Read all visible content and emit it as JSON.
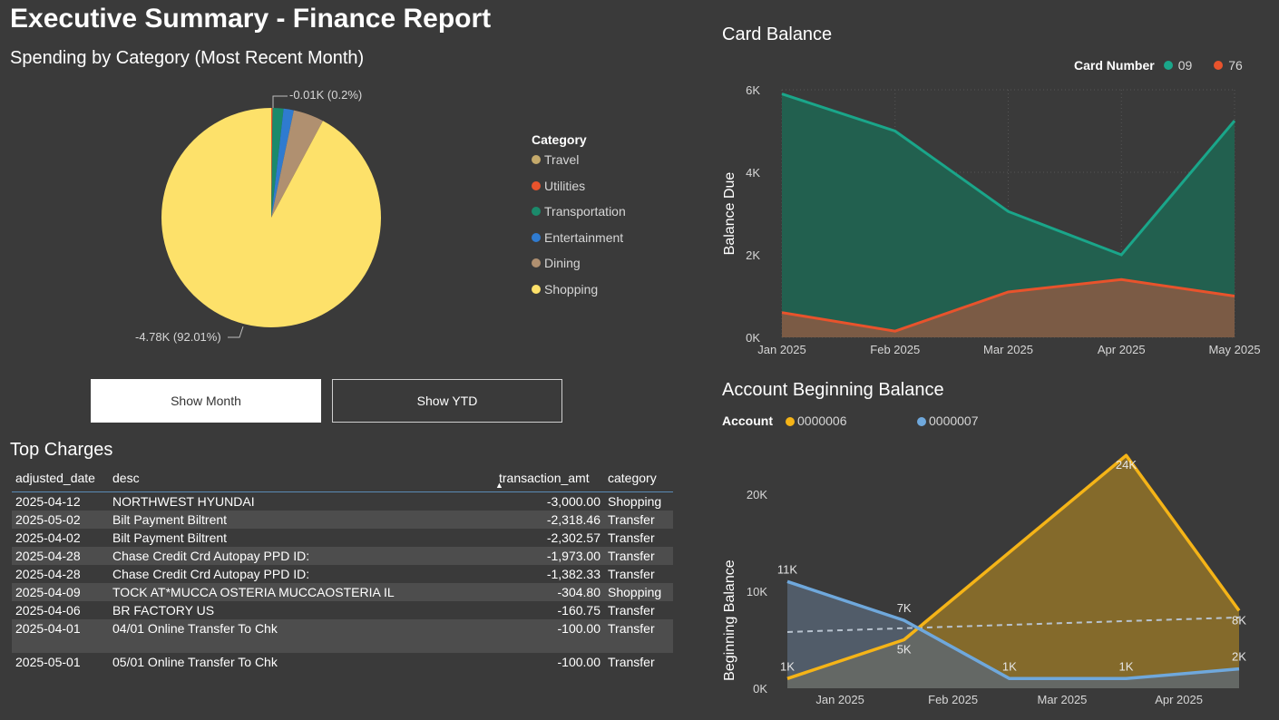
{
  "title": "Executive Summary - Finance Report",
  "pie": {
    "title": "Spending by Category (Most Recent Month)",
    "legend_title": "Category",
    "callout_top": "-0.01K (0.2%)",
    "callout_bottom": "-4.78K (92.01%)",
    "categories": [
      {
        "name": "Travel",
        "color": "#c4a96b"
      },
      {
        "name": "Utilities",
        "color": "#e8532c"
      },
      {
        "name": "Transportation",
        "color": "#1b8a6b"
      },
      {
        "name": "Entertainment",
        "color": "#2f7bd0"
      },
      {
        "name": "Dining",
        "color": "#b09070"
      },
      {
        "name": "Shopping",
        "color": "#fde16a"
      }
    ]
  },
  "buttons": {
    "month": "Show Month",
    "ytd": "Show YTD"
  },
  "card_balance": {
    "title": "Card Balance",
    "legend_title": "Card Number",
    "ylabel": "Balance Due",
    "yticks": [
      "0K",
      "2K",
      "4K",
      "6K"
    ],
    "xticks": [
      "Jan 2025",
      "Feb 2025",
      "Mar 2025",
      "Apr 2025",
      "May 2025"
    ]
  },
  "account_balance": {
    "title": "Account Beginning Balance",
    "legend_title": "Account",
    "ylabel": "Beginning Balance",
    "yticks": [
      "0K",
      "10K",
      "20K"
    ],
    "xticks": [
      "Jan 2025",
      "Feb 2025",
      "Mar 2025",
      "Apr 2025"
    ]
  },
  "chart_data": [
    {
      "type": "area",
      "title": "Card Balance",
      "ylabel": "Balance Due",
      "x": [
        "Jan 2025",
        "Feb 2025",
        "Mar 2025",
        "Apr 2025",
        "May 2025"
      ],
      "ylim": [
        0,
        6000
      ],
      "legend": "top-right",
      "series": [
        {
          "name": "09",
          "color": "#1aa68a",
          "values": [
            5900,
            5000,
            3050,
            2000,
            5250
          ]
        },
        {
          "name": "76",
          "color": "#e8532c",
          "values": [
            600,
            150,
            1100,
            1400,
            1000
          ]
        }
      ]
    },
    {
      "type": "area",
      "title": "Account Beginning Balance",
      "ylabel": "Beginning Balance",
      "ylim": [
        0,
        26000
      ],
      "legend": "top-left",
      "series": [
        {
          "name": "0000006",
          "color": "#f5b417",
          "points": [
            [
              "2025-01-01",
              1000
            ],
            [
              "2025-02-01",
              5000
            ],
            [
              "2025-04-01",
              24000
            ],
            [
              "2025-05-01",
              8000
            ]
          ],
          "labels": [
            "1K",
            "5K",
            "24K",
            "8K"
          ]
        },
        {
          "name": "0000007",
          "color": "#6fa8dc",
          "points": [
            [
              "2025-01-01",
              11000
            ],
            [
              "2025-02-01",
              7000
            ],
            [
              "2025-03-01",
              1000
            ],
            [
              "2025-04-01",
              1000
            ],
            [
              "2025-05-01",
              2000
            ]
          ],
          "labels": [
            "11K",
            "7K",
            "1K",
            "1K",
            "2K"
          ]
        }
      ],
      "trend": [
        5800,
        7300
      ]
    },
    {
      "type": "pie",
      "title": "Spending by Category (Most Recent Month)",
      "slices": [
        {
          "label": "Utilities",
          "value": 0.2
        },
        {
          "label": "Transportation",
          "value": 1.6
        },
        {
          "label": "Entertainment",
          "value": 1.5
        },
        {
          "label": "Dining",
          "value": 4.5
        },
        {
          "label": "Shopping",
          "value": 92.01
        }
      ]
    }
  ],
  "top_charges": {
    "title": "Top Charges",
    "columns": [
      "adjusted_date",
      "desc",
      "transaction_amt",
      "category"
    ],
    "rows": [
      [
        "2025-04-12",
        "NORTHWEST HYUNDAI",
        "-3,000.00",
        "Shopping"
      ],
      [
        "2025-05-02",
        "Bilt Payment Biltrent",
        "-2,318.46",
        "Transfer"
      ],
      [
        "2025-04-02",
        "Bilt Payment Biltrent",
        "-2,302.57",
        "Transfer"
      ],
      [
        "2025-04-28",
        "Chase Credit Crd Autopay PPD ID:",
        "-1,973.00",
        "Transfer"
      ],
      [
        "2025-04-28",
        "Chase Credit Crd Autopay PPD ID:",
        "-1,382.33",
        "Transfer"
      ],
      [
        "2025-04-09",
        "TOCK AT*MUCCA OSTERIA MUCCAOSTERIA IL",
        "-304.80",
        "Shopping"
      ],
      [
        "2025-04-06",
        "BR FACTORY US",
        "-160.75",
        "Transfer"
      ],
      [
        "2025-04-01",
        "04/01 Online Transfer To Chk",
        "-100.00",
        "Transfer"
      ],
      [
        "2025-05-01",
        "05/01 Online Transfer To Chk",
        "-100.00",
        "Transfer"
      ]
    ]
  }
}
